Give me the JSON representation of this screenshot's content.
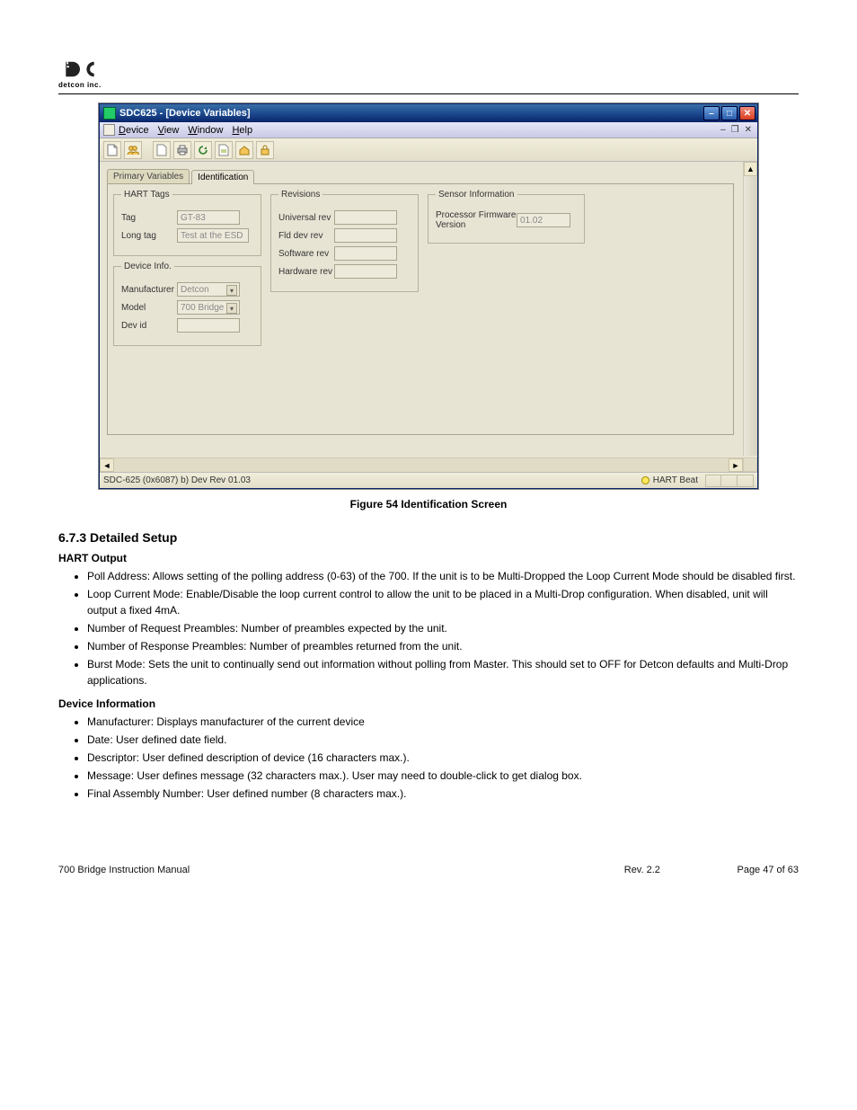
{
  "logo": {
    "brand": "detcon inc."
  },
  "window": {
    "title": "SDC625 - [Device Variables]",
    "menu": {
      "device": "Device",
      "view": "View",
      "window": "Window",
      "help": "Help"
    },
    "tabs": {
      "primary": "Primary Variables",
      "identification": "Identification"
    },
    "groups": {
      "hart_tags": {
        "legend": "HART Tags",
        "tag_label": "Tag",
        "tag_value": "GT-83",
        "longtag_label": "Long tag",
        "longtag_value": "Test at the ESD"
      },
      "device_info": {
        "legend": "Device Info.",
        "manufacturer_label": "Manufacturer",
        "manufacturer_value": "Detcon",
        "model_label": "Model",
        "model_value": "700 Bridge",
        "devid_label": "Dev id",
        "devid_value": ""
      },
      "revisions": {
        "legend": "Revisions",
        "universal_label": "Universal rev",
        "universal_value": "",
        "flddev_label": "Fld dev rev",
        "flddev_value": "",
        "software_label": "Software rev",
        "software_value": "",
        "hardware_label": "Hardware rev",
        "hardware_value": ""
      },
      "sensor_info": {
        "legend": "Sensor Information",
        "fw_label": "Processor Firmware Version",
        "fw_value": "01.02"
      }
    },
    "status": {
      "left": "SDC-625   (0x6087) b) Dev Rev 01.03",
      "hartbeat": "HART Beat"
    }
  },
  "figure_caption": "Figure 54 Identification Screen",
  "sections": {
    "detailed_setup": {
      "heading": "6.7.3 Detailed Setup",
      "hart_output": {
        "heading": "HART Output",
        "items": [
          "Poll Address: Allows setting of the polling address (0-63) of the 700. If the unit is to be Multi-Dropped the Loop Current Mode should be disabled first.",
          "Loop Current Mode: Enable/Disable the loop current control to allow the unit to be placed in a Multi-Drop configuration. When disabled, unit will output a fixed 4mA.",
          "Number of Request Preambles: Number of preambles expected by the unit.",
          "Number of Response Preambles: Number of preambles returned from the unit.",
          "Burst Mode: Sets the unit to continually send out information without polling from Master. This should set to OFF for Detcon defaults and Multi-Drop applications."
        ]
      },
      "device_information": {
        "heading": "Device Information",
        "items": [
          "Manufacturer: Displays manufacturer of the current device",
          "Date: User defined date field.",
          "Descriptor: User defined description of device (16 characters max.).",
          "Message: User defines message (32 characters max.). User may need to double-click to get dialog box.",
          "Final Assembly Number: User defined number (8 characters max.)."
        ]
      }
    }
  },
  "footer": {
    "left": "700 Bridge Instruction Manual",
    "right": "Rev. 2.2",
    "page": "Page 47 of 63"
  }
}
